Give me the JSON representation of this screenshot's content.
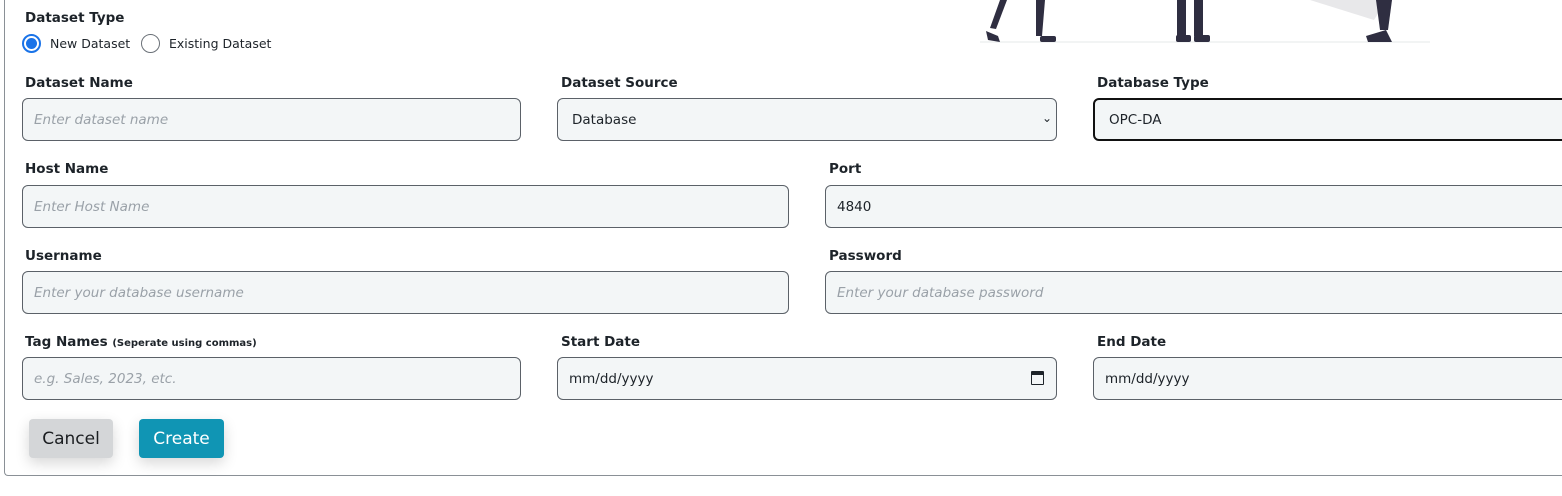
{
  "dataset_type": {
    "label": "Dataset Type",
    "options": [
      {
        "label": "New Dataset",
        "selected": true
      },
      {
        "label": "Existing Dataset",
        "selected": false
      }
    ]
  },
  "fields": {
    "dataset_name": {
      "label": "Dataset Name",
      "placeholder": "Enter dataset name",
      "value": ""
    },
    "dataset_source": {
      "label": "Dataset Source",
      "value": "Database"
    },
    "database_type": {
      "label": "Database Type",
      "value": "OPC-DA"
    },
    "host_name": {
      "label": "Host Name",
      "placeholder": "Enter Host Name",
      "value": ""
    },
    "port": {
      "label": "Port",
      "value": "4840"
    },
    "username": {
      "label": "Username",
      "placeholder": "Enter your database username",
      "value": ""
    },
    "password": {
      "label": "Password",
      "placeholder": "Enter your database password",
      "value": ""
    },
    "tag_names": {
      "label": "Tag Names",
      "hint": "(Seperate using commas)",
      "placeholder": "e.g. Sales, 2023, etc.",
      "value": ""
    },
    "start_date": {
      "label": "Start Date",
      "value": "mm/dd/yyyy"
    },
    "end_date": {
      "label": "End Date",
      "value": "mm/dd/yyyy"
    }
  },
  "buttons": {
    "cancel": "Cancel",
    "create": "Create"
  },
  "colors": {
    "accent": "#1a73e8",
    "create_button": "#1095b4",
    "cancel_button": "#d4d6d8",
    "field_background": "#f3f6f7"
  },
  "icons": [
    "select-caret-icon",
    "calendar-icon"
  ]
}
